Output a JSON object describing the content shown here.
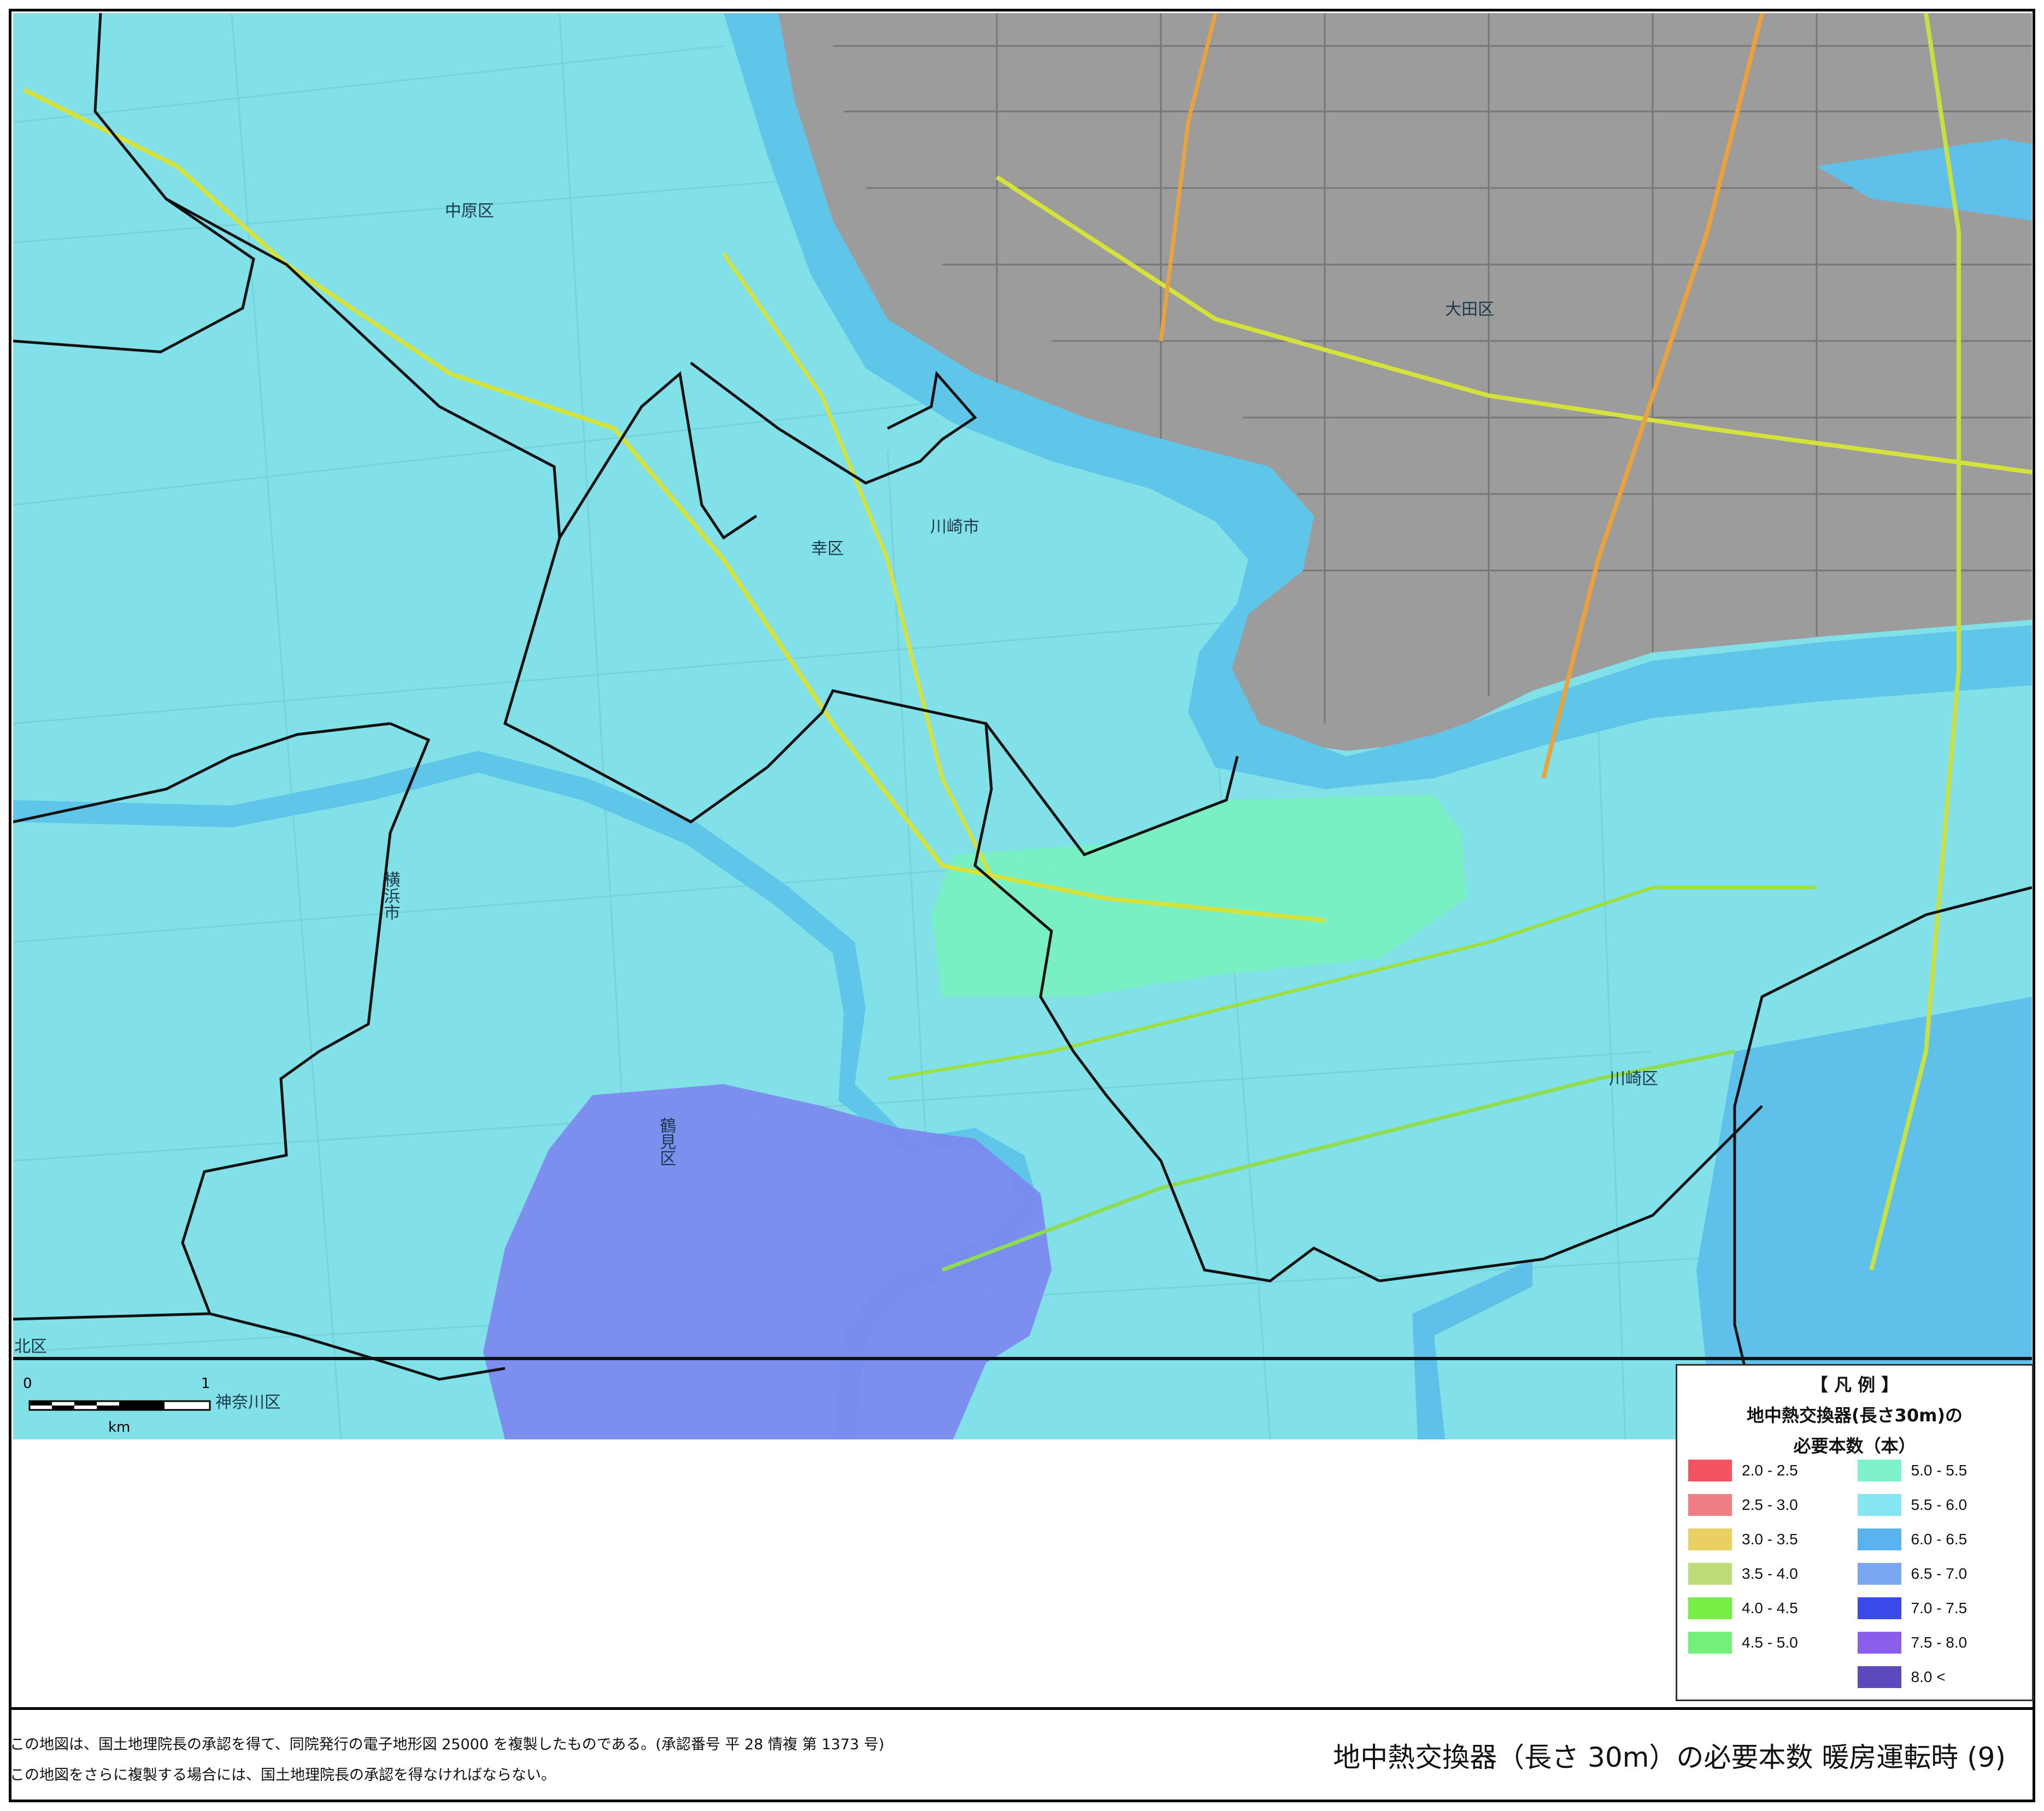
{
  "map": {
    "labels": {
      "nakahara": "中原区",
      "ota": "大田区",
      "saiwai": "幸区",
      "kawasaki_city": "川崎市",
      "kawasaki_ku": "川崎区",
      "tsurumi": "鶴見区",
      "yokohama": "横浜市",
      "kanagawa": "神奈川区",
      "kita": "北区"
    },
    "scale": {
      "zero": "0",
      "one": "1",
      "unit": "km"
    },
    "colors": {
      "base": "#82e0e8",
      "ota_urban": "#9c9c9c",
      "river": "#5fc6ea",
      "sea": "#5fc0ea",
      "green_zone": "#78f0c0",
      "blue_zone": "#7b86ee",
      "boundary": "#111111",
      "rail_main": "#d4e23a",
      "rail_orange": "#e9a23c"
    }
  },
  "legend": {
    "title_line1": "【 凡 例 】",
    "title_line2": "地中熱交換器(長さ30m)の",
    "title_line3": "必要本数（本）",
    "left_items": [
      {
        "label": "2.0 - 2.5",
        "color": "#f2555f"
      },
      {
        "label": "2.5 - 3.0",
        "color": "#f07c84"
      },
      {
        "label": "3.0 - 3.5",
        "color": "#ead062"
      },
      {
        "label": "3.5 - 4.0",
        "color": "#bedc7a"
      },
      {
        "label": "4.0 - 4.5",
        "color": "#76ee46"
      },
      {
        "label": "4.5 - 5.0",
        "color": "#74f07a"
      }
    ],
    "right_items": [
      {
        "label": "5.0 - 5.5",
        "color": "#7ef2c8"
      },
      {
        "label": "5.5 - 6.0",
        "color": "#86e6f2"
      },
      {
        "label": "6.0 - 6.5",
        "color": "#5ab2ee"
      },
      {
        "label": "6.5 - 7.0",
        "color": "#7aa8f0"
      },
      {
        "label": "7.0 - 7.5",
        "color": "#3a4ae8"
      },
      {
        "label": "7.5 - 8.0",
        "color": "#8a5ee8"
      },
      {
        "label": "8.0 <",
        "color": "#5a4abe"
      }
    ]
  },
  "footer": {
    "credit1": "この地図は、国土地理院長の承認を得て、同院発行の電子地形図 25000 を複製したものである。(承認番号 平 28 情複 第 1373 号)",
    "credit2": "この地図をさらに複製する場合には、国土地理院長の承認を得なければならない。",
    "title": "地中熱交換器（長さ 30m）の必要本数 暖房運転時 (9)"
  }
}
